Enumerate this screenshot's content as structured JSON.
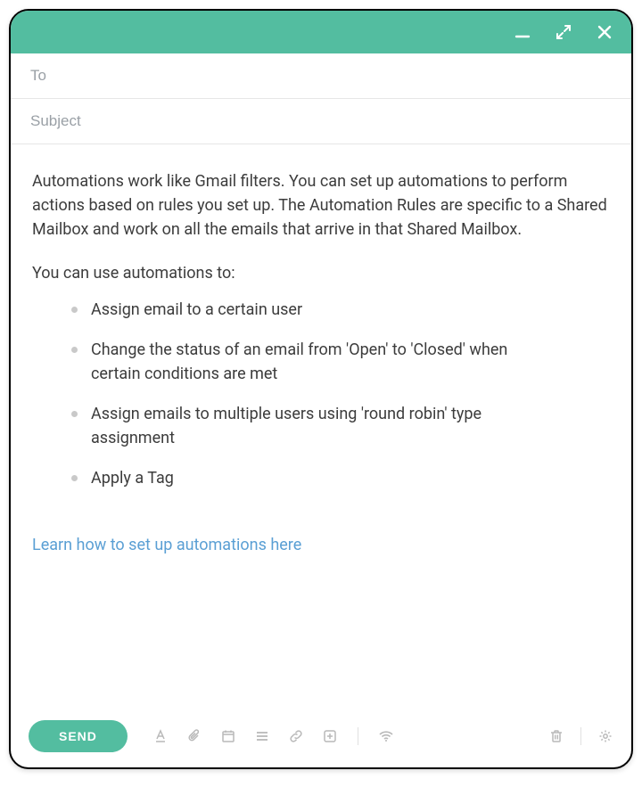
{
  "colors": {
    "accent": "#53bda0",
    "link": "#5a9fd4"
  },
  "fields": {
    "to": {
      "placeholder": "To",
      "value": ""
    },
    "subject": {
      "placeholder": "Subject",
      "value": ""
    }
  },
  "body": {
    "intro": "Automations work like Gmail filters. You can set up automations to perform actions based on rules you set up. The Automation Rules are specific to a Shared Mailbox and work on all the emails that arrive in that Shared Mailbox.",
    "lead": "You can use automations to:",
    "bullets": [
      "Assign email to a certain user",
      "Change the status of an email from 'Open' to 'Closed' when certain conditions are met",
      "Assign emails to multiple users using 'round robin' type assignment",
      "Apply a Tag"
    ],
    "link_text": "Learn how to set up automations here"
  },
  "footer": {
    "send_label": "SEND"
  }
}
